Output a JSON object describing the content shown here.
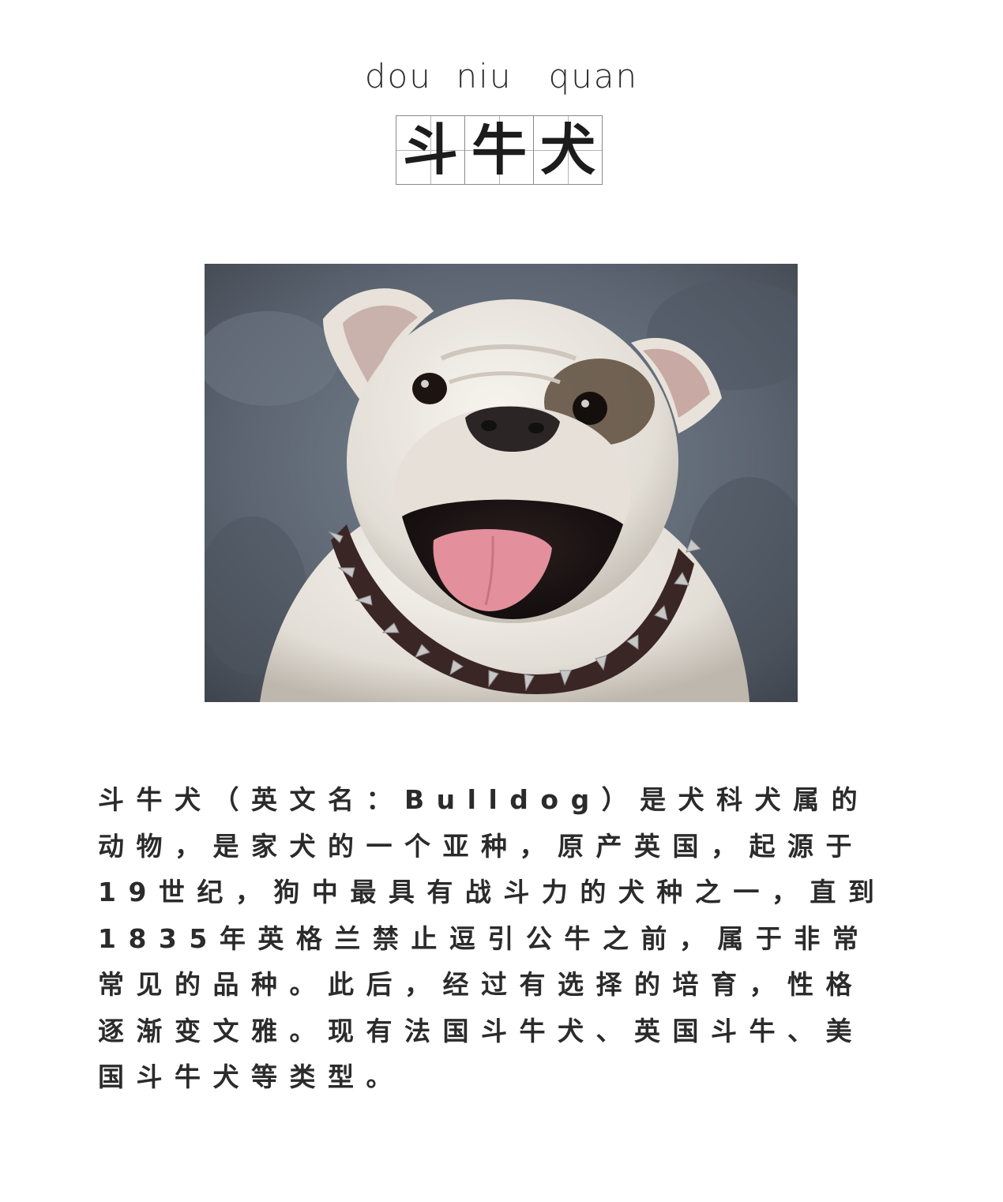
{
  "header": {
    "pinyin": "dou  niu   quan",
    "title_chars": [
      "斗",
      "牛",
      "犬"
    ]
  },
  "photo": {
    "subject": "dog-photo",
    "colors": {
      "background": "#5b6470",
      "fur": "#ece8e2",
      "patch": "#5a4a3a",
      "tongue": "#e3909c",
      "collar": "#3a2624",
      "spike": "#c7c7c7"
    }
  },
  "description": {
    "text": "斗牛犬（英文名：Bulldog）是犬科犬属的动物，是家犬的一个亚种，原产英国，起源于19世纪，狗中最具有战斗力的犬种之一，直到1835年英格兰禁止逗引公牛之前，属于非常常见的品种。此后，经过有选择的培育，性格逐渐变文雅。现有法国斗牛犬、英国斗牛、美国斗牛犬等类型。"
  }
}
